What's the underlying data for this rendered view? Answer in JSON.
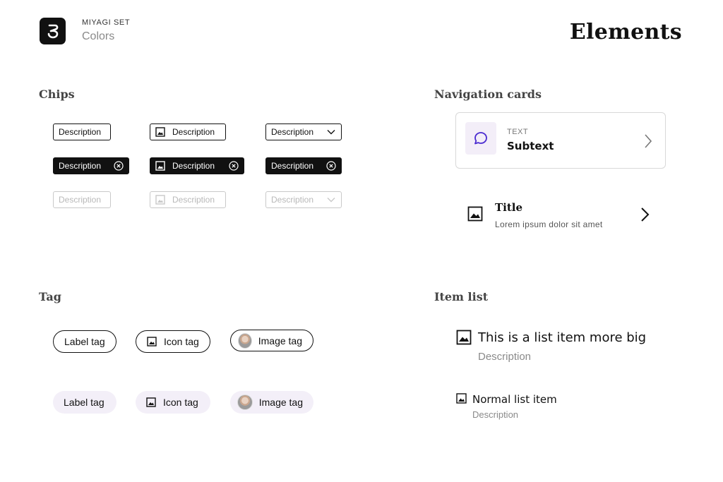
{
  "header": {
    "brand_set": "MIYAGI SET",
    "brand_subtitle": "Colors",
    "page_title": "Elements"
  },
  "sections": {
    "chips": "Chips",
    "navigation_cards": "Navigation cards",
    "tag": "Tag",
    "item_list": "Item list"
  },
  "chips": {
    "rows": [
      {
        "state": "outlined",
        "labels": [
          "Description",
          "Description",
          "Description"
        ]
      },
      {
        "state": "filled-removable",
        "labels": [
          "Description",
          "Description",
          "Description"
        ]
      },
      {
        "state": "disabled",
        "labels": [
          "Description",
          "Description",
          "Description"
        ]
      }
    ],
    "icons": {
      "image": "image-icon",
      "dropdown": "chevron-down-icon",
      "remove": "close-circle-icon"
    }
  },
  "tags": {
    "outline": [
      "Label tag",
      "Icon tag",
      "Image tag"
    ],
    "soft": [
      "Label tag",
      "Icon tag",
      "Image tag"
    ]
  },
  "navigation_cards": {
    "card1": {
      "overline": "TEXT",
      "subtext": "Subtext",
      "icon": "chat-bubble-icon",
      "trailing_icon": "chevron-right-icon"
    },
    "card2": {
      "title": "Title",
      "description": "Lorem ipsum dolor sit amet",
      "icon": "image-icon",
      "trailing_icon": "chevron-right-icon"
    }
  },
  "item_list": {
    "items": [
      {
        "title": "This is a list item more big",
        "description": "Description",
        "icon": "image-icon"
      },
      {
        "title": "Normal list item",
        "description": "Description",
        "icon": "image-icon"
      }
    ]
  },
  "colors": {
    "ink": "#111111",
    "muted": "#8a8a8a",
    "accent_purple": "#4a2bd0",
    "soft_lavender": "#f3eff8",
    "disabled": "#c9c9c9"
  }
}
